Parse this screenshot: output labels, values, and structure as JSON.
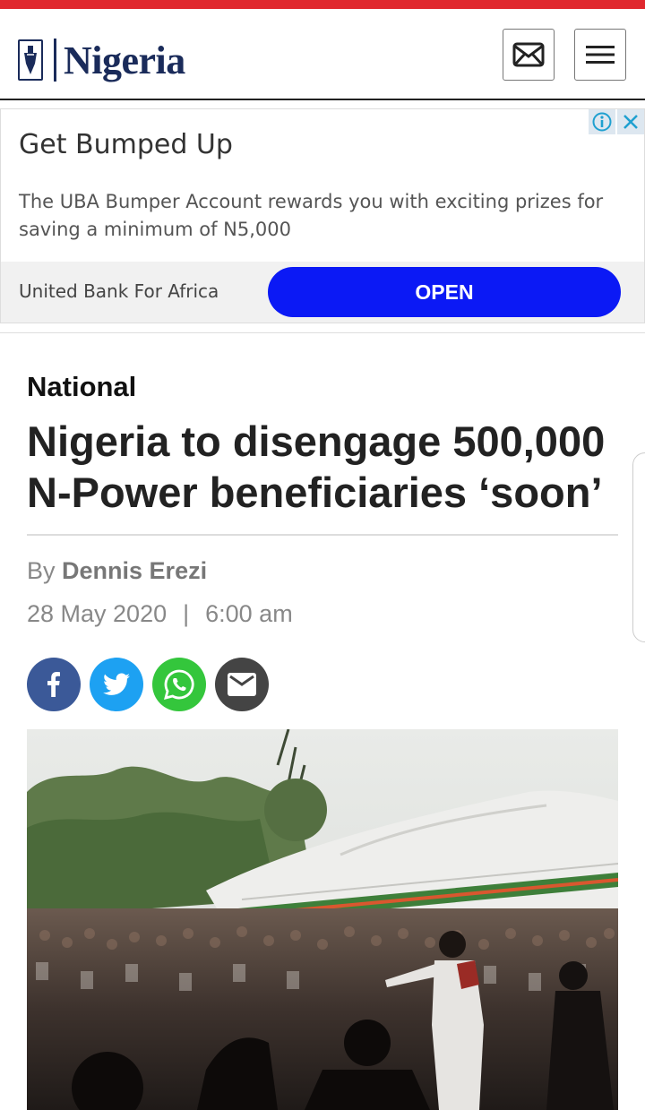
{
  "header": {
    "site_name": "Nigeria",
    "mail_icon": "mail-icon",
    "menu_icon": "hamburger-icon"
  },
  "ad": {
    "title": "Get Bumped Up",
    "description": "The UBA Bumper Account rewards you with exciting prizes for saving a minimum of N5,000",
    "advertiser": "United Bank For Africa",
    "cta": "OPEN",
    "cta_color": "#0b19f5"
  },
  "article": {
    "category": "National",
    "headline": "Nigeria to disengage 500,000 N-Power beneficiaries ‘soon’",
    "by_prefix": "By",
    "author": "Dennis Erezi",
    "date": "28 May 2020",
    "separator": "|",
    "time": "6:00 am"
  },
  "share": [
    {
      "icon": "facebook-icon",
      "color": "#3b5998"
    },
    {
      "icon": "twitter-icon",
      "color": "#1da1f2"
    },
    {
      "icon": "whatsapp-icon",
      "color": "#34c63c"
    },
    {
      "icon": "email-icon",
      "color": "#444444"
    }
  ],
  "colors": {
    "top_bar": "#e0282e",
    "brand": "#1a2b5a"
  }
}
